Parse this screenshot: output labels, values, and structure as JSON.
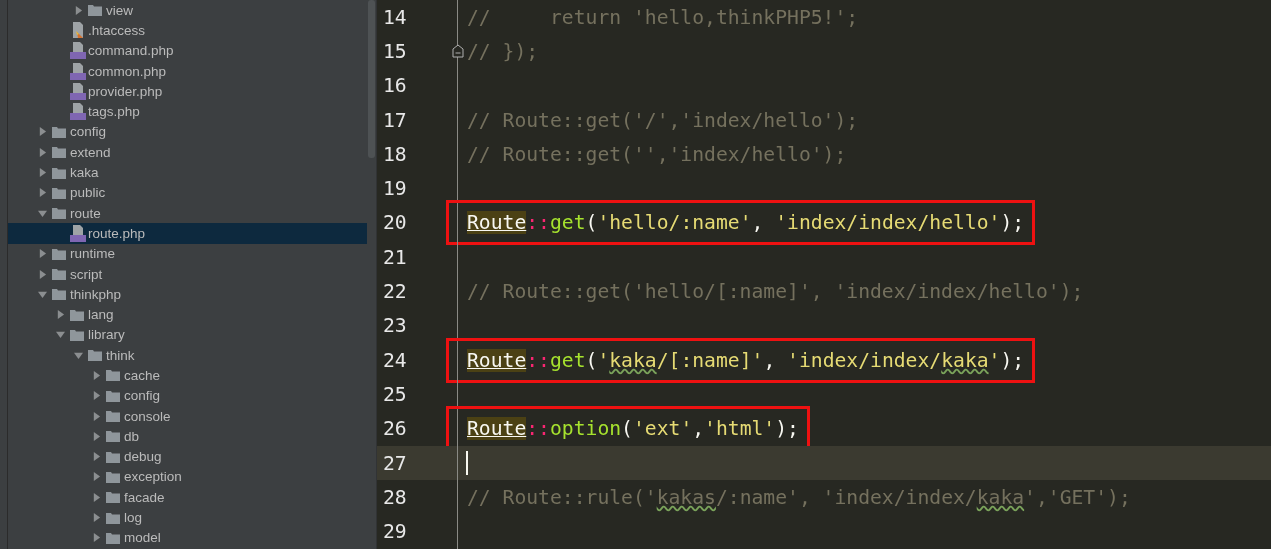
{
  "tree": [
    {
      "children": [
        {
          "children": [
            {
              "name": "view",
              "kind": "folder",
              "expanded": false,
              "selected": false
            }
          ]
        },
        {
          "name": ".htaccess",
          "kind": "htaccess",
          "selected": false
        },
        {
          "name": "command.php",
          "kind": "php",
          "selected": false
        },
        {
          "name": "common.php",
          "kind": "php",
          "selected": false
        },
        {
          "name": "provider.php",
          "kind": "php",
          "selected": false
        },
        {
          "name": "tags.php",
          "kind": "php",
          "selected": false
        }
      ]
    },
    {
      "name": "config",
      "kind": "folder",
      "expanded": false,
      "selected": false
    },
    {
      "name": "extend",
      "kind": "folder",
      "expanded": false,
      "selected": false
    },
    {
      "name": "kaka",
      "kind": "folder",
      "expanded": false,
      "selected": false
    },
    {
      "name": "public",
      "kind": "folder",
      "expanded": false,
      "selected": false
    },
    {
      "name": "route",
      "kind": "folder",
      "expanded": true,
      "selected": false,
      "children": [
        {
          "name": "route.php",
          "kind": "php",
          "selected": true
        }
      ]
    },
    {
      "name": "runtime",
      "kind": "folder",
      "expanded": false,
      "selected": false
    },
    {
      "name": "script",
      "kind": "folder",
      "expanded": false,
      "selected": false
    },
    {
      "name": "thinkphp",
      "kind": "folder",
      "expanded": true,
      "selected": false,
      "children": [
        {
          "name": "lang",
          "kind": "folder",
          "expanded": false,
          "selected": false
        },
        {
          "name": "library",
          "kind": "folder",
          "expanded": true,
          "selected": false,
          "children": [
            {
              "name": "think",
              "kind": "folder",
              "expanded": true,
              "selected": false,
              "children": [
                {
                  "name": "cache",
                  "kind": "folder",
                  "expanded": false,
                  "selected": false
                },
                {
                  "name": "config",
                  "kind": "folder",
                  "expanded": false,
                  "selected": false
                },
                {
                  "name": "console",
                  "kind": "folder",
                  "expanded": false,
                  "selected": false
                },
                {
                  "name": "db",
                  "kind": "folder",
                  "expanded": false,
                  "selected": false
                },
                {
                  "name": "debug",
                  "kind": "folder",
                  "expanded": false,
                  "selected": false
                },
                {
                  "name": "exception",
                  "kind": "folder",
                  "expanded": false,
                  "selected": false
                },
                {
                  "name": "facade",
                  "kind": "folder",
                  "expanded": false,
                  "selected": false
                },
                {
                  "name": "log",
                  "kind": "folder",
                  "expanded": false,
                  "selected": false
                },
                {
                  "name": "model",
                  "kind": "folder",
                  "expanded": false,
                  "selected": false
                }
              ]
            }
          ]
        }
      ]
    }
  ],
  "lines": [
    {
      "number": "14",
      "fold": false,
      "boxed": false,
      "current": false,
      "tokens": [
        {
          "kind": "comment",
          "text": "//     return 'hello,thinkPHP5!';"
        }
      ]
    },
    {
      "number": "15",
      "fold": true,
      "boxed": false,
      "current": false,
      "tokens": [
        {
          "kind": "comment",
          "text": "// });"
        }
      ]
    },
    {
      "number": "16",
      "fold": false,
      "boxed": false,
      "current": false
    },
    {
      "number": "17",
      "fold": false,
      "boxed": false,
      "current": false,
      "tokens": [
        {
          "kind": "comment",
          "text": "// Route::get('/','index/hello');"
        }
      ]
    },
    {
      "number": "18",
      "fold": false,
      "boxed": false,
      "current": false,
      "tokens": [
        {
          "kind": "comment",
          "text": "// Route::get('','index/hello');"
        }
      ]
    },
    {
      "number": "19",
      "fold": false,
      "boxed": false,
      "current": false
    },
    {
      "number": "20",
      "fold": false,
      "boxed": true,
      "current": false,
      "tokens": [
        {
          "kind": "ref",
          "text": "Route"
        },
        {
          "kind": "op",
          "text": "::"
        },
        {
          "kind": "method",
          "text": "get"
        },
        {
          "kind": "punct",
          "text": "("
        },
        {
          "kind": "string",
          "text": "'hello/:name'"
        },
        {
          "kind": "punct",
          "text": ", "
        },
        {
          "kind": "string",
          "text": "'index/index/hello'"
        },
        {
          "kind": "punct",
          "text": ");"
        }
      ]
    },
    {
      "number": "21",
      "fold": false,
      "boxed": false,
      "current": false
    },
    {
      "number": "22",
      "fold": false,
      "boxed": false,
      "current": false,
      "tokens": [
        {
          "kind": "comment",
          "text": "// Route::get('hello/[:name]', 'index/index/hello');"
        }
      ]
    },
    {
      "number": "23",
      "fold": false,
      "boxed": false,
      "current": false
    },
    {
      "number": "24",
      "fold": false,
      "boxed": true,
      "current": false,
      "tokens": [
        {
          "kind": "ref",
          "text": "Route"
        },
        {
          "kind": "op",
          "text": "::"
        },
        {
          "kind": "method",
          "text": "get"
        },
        {
          "kind": "punct",
          "text": "("
        },
        {
          "kind": "string",
          "text": "'"
        },
        {
          "kind": "typo-string",
          "text": "kaka"
        },
        {
          "kind": "string",
          "text": "/[:name]'"
        },
        {
          "kind": "punct",
          "text": ", "
        },
        {
          "kind": "string",
          "text": "'index/index/"
        },
        {
          "kind": "typo-string",
          "text": "kaka"
        },
        {
          "kind": "string",
          "text": "'"
        },
        {
          "kind": "punct",
          "text": ");"
        }
      ]
    },
    {
      "number": "25",
      "fold": false,
      "boxed": false,
      "current": false
    },
    {
      "number": "26",
      "fold": false,
      "boxed": true,
      "current": false,
      "tokens": [
        {
          "kind": "ref",
          "text": "Route"
        },
        {
          "kind": "op",
          "text": "::"
        },
        {
          "kind": "method",
          "text": "option"
        },
        {
          "kind": "punct",
          "text": "("
        },
        {
          "kind": "string",
          "text": "'ext'"
        },
        {
          "kind": "punct",
          "text": ","
        },
        {
          "kind": "string",
          "text": "'html'"
        },
        {
          "kind": "punct",
          "text": ");"
        }
      ]
    },
    {
      "number": "27",
      "fold": false,
      "boxed": false,
      "current": true
    },
    {
      "number": "28",
      "fold": false,
      "boxed": false,
      "current": false,
      "tokens": [
        {
          "kind": "comment",
          "text": "// Route::rule('"
        },
        {
          "kind": "typo-comment",
          "text": "kakas"
        },
        {
          "kind": "comment",
          "text": "/:name', 'index/index/"
        },
        {
          "kind": "typo-comment",
          "text": "kaka"
        },
        {
          "kind": "comment",
          "text": "','GET');"
        }
      ]
    },
    {
      "number": "29",
      "fold": false,
      "boxed": false,
      "current": false
    }
  ]
}
